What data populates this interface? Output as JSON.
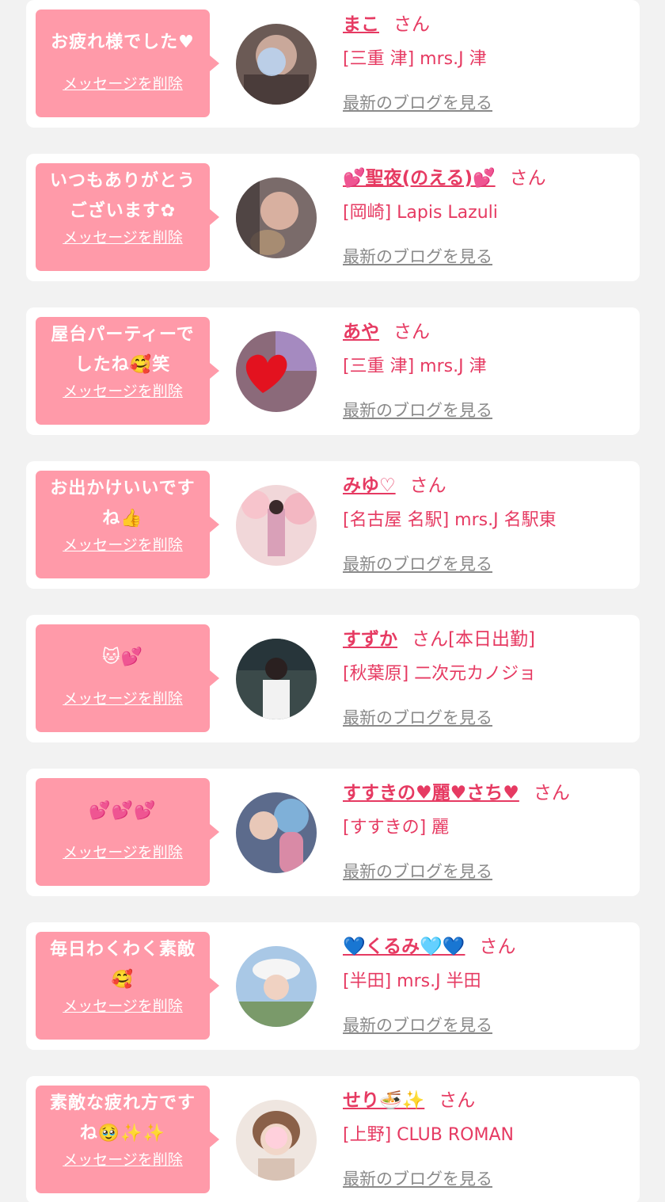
{
  "colors": {
    "background": "#f2f2f2",
    "card": "#ffffff",
    "bubble": "#ff9aa9",
    "accent": "#e63a62",
    "link_gray": "#8a8a8a"
  },
  "entries": [
    {
      "message_lines": [
        "お疲れ様でした♥"
      ],
      "delete_label": "メッセージを削除",
      "name": "まこ",
      "honorific": "さん",
      "shop": "[三重 津] mrs.J 津",
      "blog_label": "最新のブログを見る",
      "avatar": "photo-avatar"
    },
    {
      "message_lines": [
        "いつもありがとう",
        "ございます✿"
      ],
      "delete_label": "メッセージを削除",
      "name": "💕聖夜(のえる)💕",
      "honorific": "さん",
      "shop": "[岡崎] Lapis Lazuli",
      "blog_label": "最新のブログを見る",
      "avatar": "photo-avatar"
    },
    {
      "message_lines": [
        "屋台パーティーで",
        "したね🥰笑"
      ],
      "delete_label": "メッセージを削除",
      "name": "あや",
      "honorific": "さん",
      "shop": "[三重 津] mrs.J 津",
      "blog_label": "最新のブログを見る",
      "avatar": "heart-avatar"
    },
    {
      "message_lines": [
        "お出かけいいです",
        "ね👍"
      ],
      "delete_label": "メッセージを削除",
      "name": "みゆ♡",
      "honorific": "さん",
      "shop": "[名古屋 名駅] mrs.J 名駅東",
      "blog_label": "最新のブログを見る",
      "avatar": "photo-avatar"
    },
    {
      "message_lines": [
        "🐱💕"
      ],
      "delete_label": "メッセージを削除",
      "name": "すずか",
      "honorific": "さん[本日出勤]",
      "shop": "[秋葉原] 二次元カノジョ",
      "blog_label": "最新のブログを見る",
      "avatar": "photo-avatar"
    },
    {
      "message_lines": [
        "💕💕💕"
      ],
      "delete_label": "メッセージを削除",
      "name": "すすきの♥麗♥さち♥",
      "honorific": "さん",
      "shop": "[すすきの] 麗",
      "blog_label": "最新のブログを見る",
      "avatar": "photo-avatar"
    },
    {
      "message_lines": [
        "毎日わくわく素敵",
        "🥰"
      ],
      "delete_label": "メッセージを削除",
      "name": "💙くるみ🩵💙",
      "honorific": "さん",
      "shop": "[半田] mrs.J 半田",
      "blog_label": "最新のブログを見る",
      "avatar": "photo-avatar"
    },
    {
      "message_lines": [
        "素敵な疲れ方です",
        "ね🥹✨✨"
      ],
      "delete_label": "メッセージを削除",
      "name": "せり🍜✨",
      "honorific": "さん",
      "shop": "[上野] CLUB ROMAN",
      "blog_label": "最新のブログを見る",
      "avatar": "photo-avatar"
    }
  ]
}
